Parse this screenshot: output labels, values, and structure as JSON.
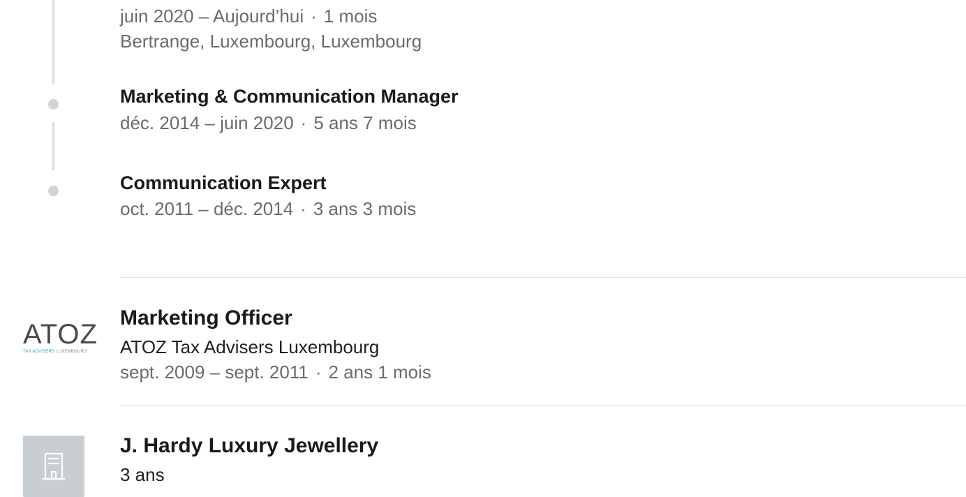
{
  "group_position": {
    "current_role": {
      "dates": "juin 2020 – Aujourd’hui",
      "duration": "1 mois",
      "location": "Bertrange, Luxembourg, Luxembourg"
    },
    "roles": [
      {
        "title": "Marketing & Communication Manager",
        "dates": "déc. 2014 – juin 2020",
        "duration": "5 ans 7 mois"
      },
      {
        "title": "Communication Expert",
        "dates": "oct. 2011 – déc. 2014",
        "duration": "3 ans 3 mois"
      }
    ]
  },
  "positions": [
    {
      "title": "Marketing Officer",
      "company": "ATOZ Tax Advisers Luxembourg",
      "dates": "sept. 2009 – sept. 2011",
      "duration": "2 ans 1 mois",
      "logo": {
        "word": "ATOZ",
        "tagline_part1": "TAX ADVISERS",
        "tagline_part2": "LUXEMBOURG"
      }
    },
    {
      "title": "J. Hardy Luxury Jewellery",
      "duration": "3 ans",
      "logo": "building-icon"
    }
  ],
  "separator": "·",
  "colors": {
    "text_primary": "#1a1a1a",
    "text_secondary": "#6b6b6b",
    "timeline": "#dcdcdc",
    "divider": "#e2e2e2",
    "atoz_teal": "#2aa3b3",
    "placeholder_bg": "#c9ced3"
  }
}
